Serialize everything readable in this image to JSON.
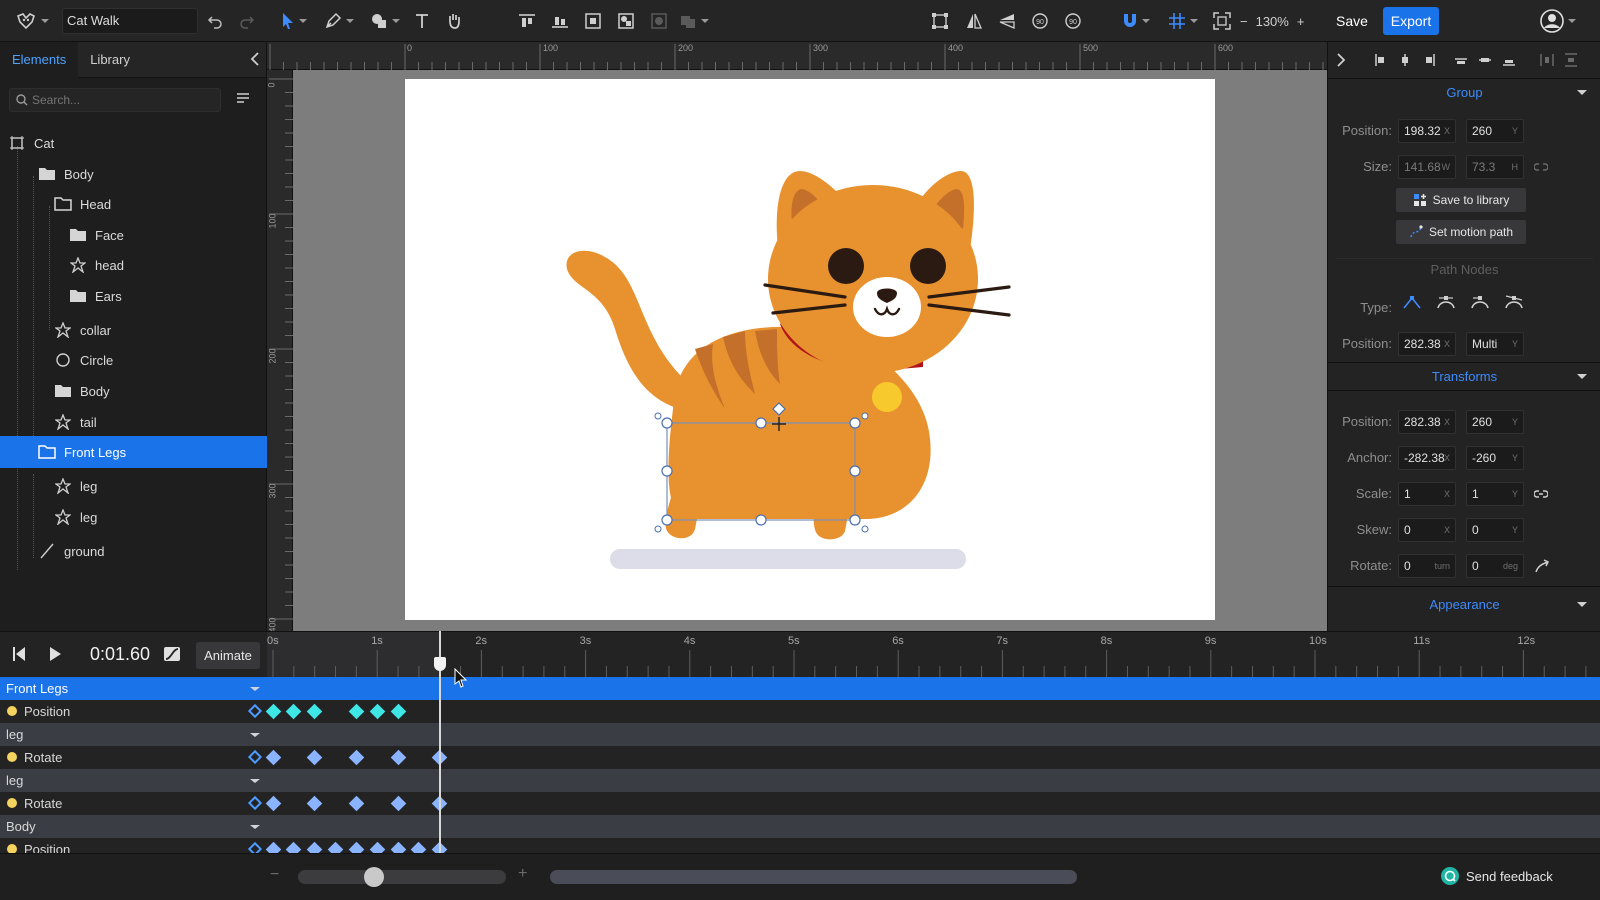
{
  "app": {
    "doc_name": "Cat Walk",
    "zoom": "130%",
    "save_label": "Save",
    "export_label": "Export"
  },
  "left_panel": {
    "tabs": [
      "Elements",
      "Library"
    ],
    "search_placeholder": "Search...",
    "tree": [
      {
        "label": "Cat",
        "icon": "artboard-icon"
      },
      {
        "label": "Body",
        "icon": "folder-icon"
      },
      {
        "label": "Head",
        "icon": "folder-icon"
      },
      {
        "label": "Face",
        "icon": "folder-icon"
      },
      {
        "label": "head",
        "icon": "shape-icon"
      },
      {
        "label": "Ears",
        "icon": "folder-icon"
      },
      {
        "label": "collar",
        "icon": "shape-icon"
      },
      {
        "label": "Circle",
        "icon": "circle-icon"
      },
      {
        "label": "Body",
        "icon": "folder-icon"
      },
      {
        "label": "tail",
        "icon": "shape-icon"
      },
      {
        "label": "Front Legs",
        "icon": "folder-icon",
        "selected": true
      },
      {
        "label": "leg",
        "icon": "shape-icon"
      },
      {
        "label": "leg",
        "icon": "shape-icon"
      },
      {
        "label": "ground",
        "icon": "line-icon"
      }
    ]
  },
  "rulers": {
    "h_labels": [
      "0",
      "100",
      "200",
      "300",
      "400",
      "500",
      "600"
    ],
    "v_labels": [
      "0",
      "100",
      "200",
      "300",
      "400"
    ]
  },
  "right_panel": {
    "group": {
      "title": "Group",
      "position_label": "Position:",
      "position_x": "198.32",
      "position_y": "260",
      "size_label": "Size:",
      "size_w": "141.68",
      "size_h": "73.3",
      "save_library": "Save to library",
      "motion_path": "Set motion path"
    },
    "path_nodes": {
      "title": "Path Nodes",
      "type_label": "Type:",
      "position_label": "Position:",
      "position_x": "282.38",
      "position_y": "Multi"
    },
    "transforms": {
      "title": "Transforms",
      "position_label": "Position:",
      "position_x": "282.38",
      "position_y": "260",
      "anchor_label": "Anchor:",
      "anchor_x": "-282.38",
      "anchor_y": "-260",
      "scale_label": "Scale:",
      "scale_x": "1",
      "scale_y": "1",
      "skew_label": "Skew:",
      "skew_x": "0",
      "skew_y": "0",
      "rotate_label": "Rotate:",
      "rotate_turn": "0",
      "rotate_deg": "0"
    },
    "appearance": {
      "title": "Appearance"
    },
    "units": {
      "x": "X",
      "y": "Y",
      "w": "W",
      "h": "H",
      "turn": "turn",
      "deg": "deg"
    }
  },
  "timeline": {
    "current_time": "0:01.60",
    "animate_label": "Animate",
    "ticks": [
      "0s",
      "1s",
      "2s",
      "3s",
      "4s",
      "5s",
      "6s",
      "7s",
      "8s",
      "9s",
      "10s",
      "11s",
      "12s"
    ],
    "tracks": [
      {
        "kind": "group",
        "name": "Front Legs",
        "selected": true
      },
      {
        "kind": "prop",
        "name": "Position",
        "keyframes_s": [
          0.0,
          0.2,
          0.4,
          0.8,
          1.0,
          1.2
        ],
        "color": "#3ee6e6"
      },
      {
        "kind": "group",
        "name": "leg"
      },
      {
        "kind": "prop",
        "name": "Rotate",
        "keyframes_s": [
          0.0,
          0.4,
          0.8,
          1.2,
          1.6
        ],
        "color": "#8ab4ff"
      },
      {
        "kind": "group",
        "name": "leg"
      },
      {
        "kind": "prop",
        "name": "Rotate",
        "keyframes_s": [
          0.0,
          0.4,
          0.8,
          1.2,
          1.6
        ],
        "color": "#8ab4ff"
      },
      {
        "kind": "group",
        "name": "Body"
      },
      {
        "kind": "prop",
        "name": "Position",
        "keyframes_s": [
          0.0,
          0.2,
          0.4,
          0.6,
          0.8,
          1.0,
          1.2,
          1.4,
          1.6
        ],
        "color": "#8ab4ff"
      }
    ],
    "playhead_s": 1.6,
    "feedback_label": "Send feedback"
  },
  "colors": {
    "accent": "#1a73e8",
    "cat_orange": "#e8922f",
    "collar_red": "#b0151c",
    "bell": "#f7c92c"
  }
}
